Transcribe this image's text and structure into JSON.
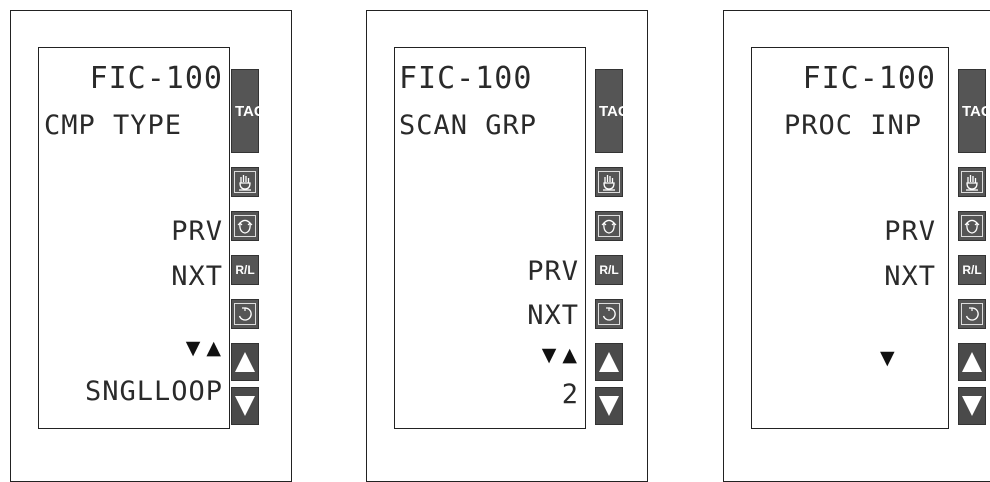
{
  "panels": [
    {
      "line1": "FIC-100",
      "line2": "CMP TYPE",
      "prv": "PRV",
      "nxt": "NXT",
      "arrows": "▼ ▲",
      "bottom": "SNGLLOOP"
    },
    {
      "line1": "FIC-100",
      "line2": "SCAN GRP",
      "prv": "PRV",
      "nxt": "NXT",
      "arrows": "▼ ▲",
      "bottom": "2"
    },
    {
      "line1": "FIC-100",
      "line2": "PROC INP",
      "prv": "PRV",
      "nxt": "NXT",
      "arrows": "▼",
      "bottom": ""
    }
  ],
  "buttons": {
    "tag": "TAG",
    "rl": "R/L",
    "up": "▲",
    "down": "▼"
  },
  "icons": [
    "hand-icon",
    "flip-icon",
    "rl-label",
    "cycle-icon",
    "up-arrow-icon",
    "down-arrow-icon"
  ],
  "colors": {
    "button": "#555555",
    "lcd_text": "#2a2a2a",
    "frame": "#222222"
  }
}
